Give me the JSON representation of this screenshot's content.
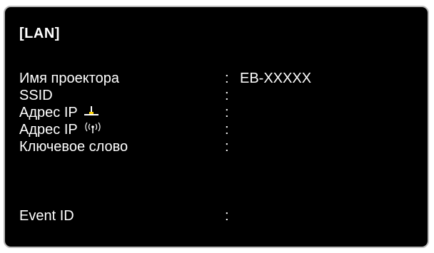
{
  "panel": {
    "title": "[LAN]",
    "rows": [
      {
        "label": "Имя проектора",
        "colon": ":",
        "value": "EB-XXXXX",
        "icon": ""
      },
      {
        "label": "SSID",
        "colon": ":",
        "value": "",
        "icon": ""
      },
      {
        "label": "Адрес IP",
        "colon": ":",
        "value": "",
        "icon": "wired-lan-icon"
      },
      {
        "label": "Адрес IP",
        "colon": ":",
        "value": "",
        "icon": "wireless-lan-icon"
      },
      {
        "label": "Ключевое слово",
        "colon": ":",
        "value": "",
        "icon": ""
      },
      {
        "label": "Event ID",
        "colon": ":",
        "value": "",
        "icon": ""
      }
    ]
  },
  "colors": {
    "background": "#000000",
    "text": "#ffffff",
    "frame": "#b8b8b8",
    "wired_icon_accent": "#ffd400"
  }
}
